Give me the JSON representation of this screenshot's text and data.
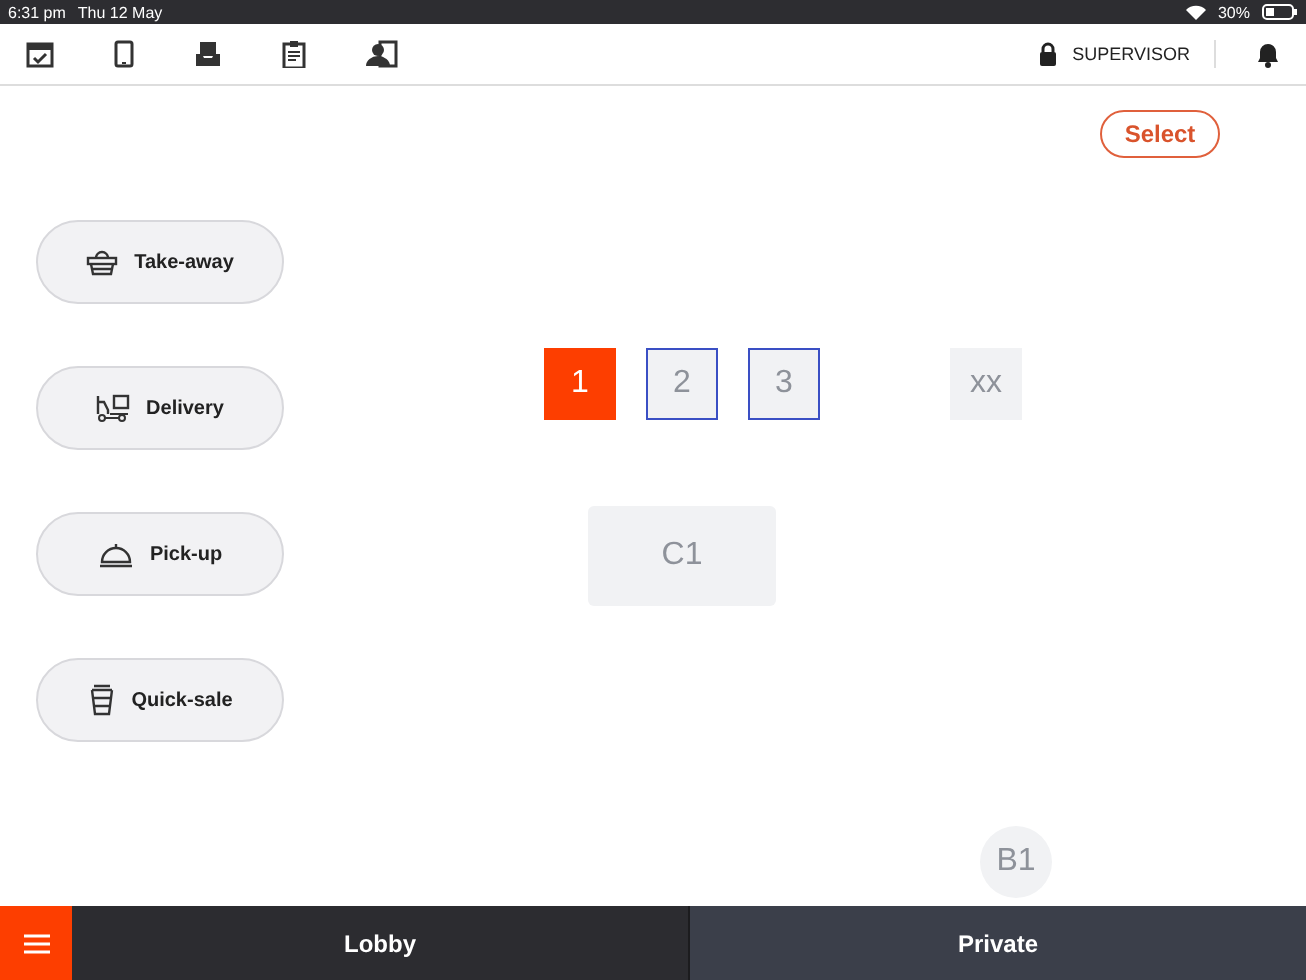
{
  "status_bar": {
    "time": "6:31 pm",
    "date": "Thu 12 May",
    "battery": "30%"
  },
  "toolbar": {
    "user": "SUPERVISOR"
  },
  "select_button": "Select",
  "order_types": [
    {
      "kind": "takeaway",
      "label": "Take-away"
    },
    {
      "kind": "delivery",
      "label": "Delivery"
    },
    {
      "kind": "pickup",
      "label": "Pick-up"
    },
    {
      "kind": "quicksale",
      "label": "Quick-sale"
    }
  ],
  "tables": [
    {
      "label": "1",
      "kind": "square",
      "occupied": true,
      "selected": false
    },
    {
      "label": "2",
      "kind": "square",
      "occupied": false,
      "selected": true
    },
    {
      "label": "3",
      "kind": "square",
      "occupied": false,
      "selected": true
    },
    {
      "label": "xx",
      "kind": "square",
      "occupied": false,
      "selected": false
    },
    {
      "label": "C1",
      "kind": "rect",
      "occupied": false,
      "selected": false
    },
    {
      "label": "B1",
      "kind": "round",
      "occupied": false,
      "selected": false
    }
  ],
  "tabs": [
    {
      "label": "Lobby",
      "selected": true
    },
    {
      "label": "Private",
      "selected": false
    }
  ]
}
